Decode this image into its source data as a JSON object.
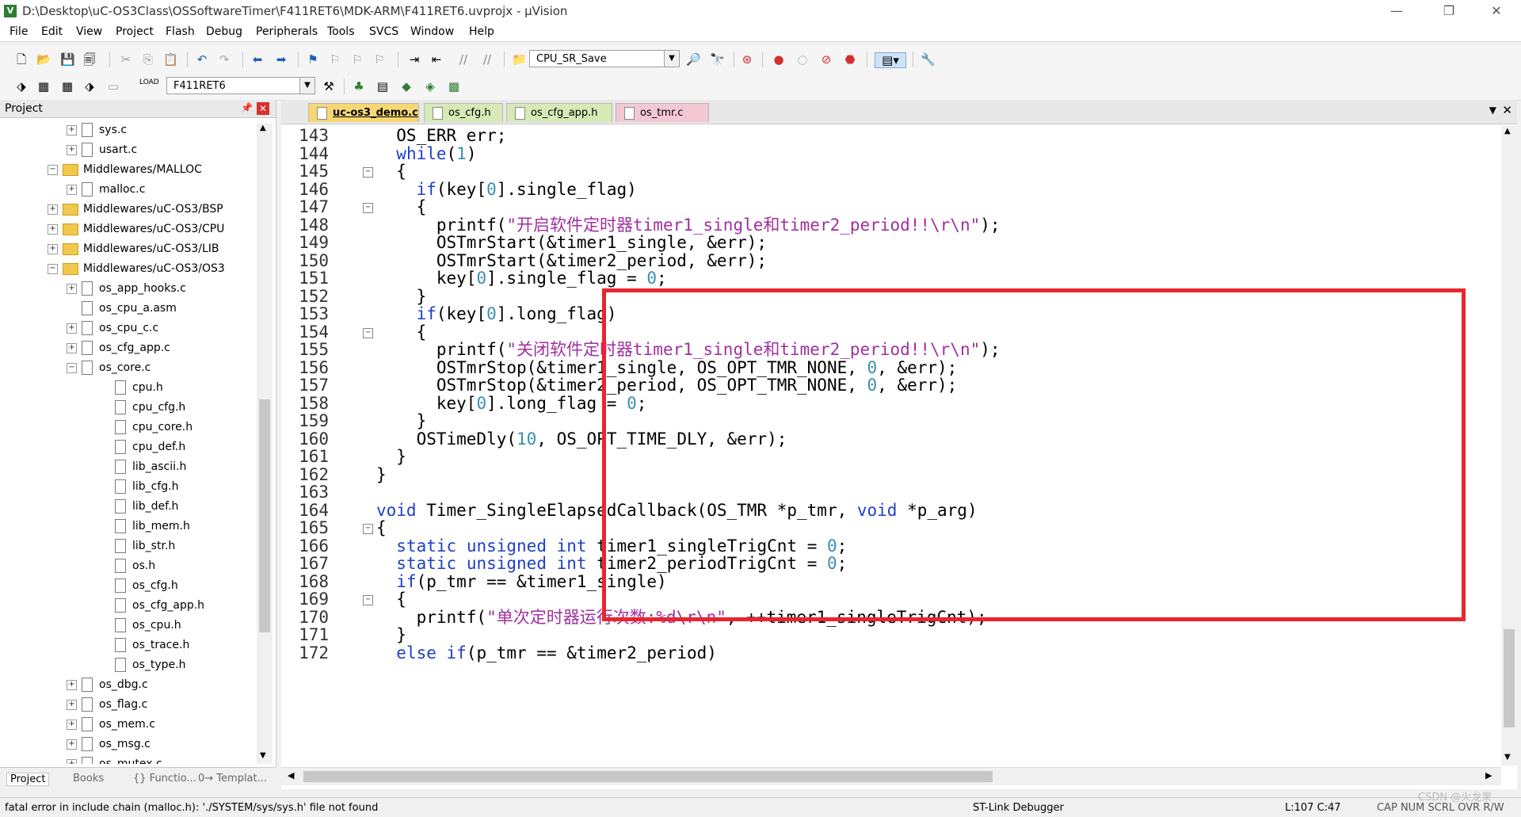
{
  "window": {
    "title": "D:\\Desktop\\uC-OS3Class\\OSSoftwareTimer\\F411RET6\\MDK-ARM\\F411RET6.uvprojx - µVision",
    "app_icon": "V"
  },
  "menu": [
    "File",
    "Edit",
    "View",
    "Project",
    "Flash",
    "Debug",
    "Peripherals",
    "Tools",
    "SVCS",
    "Window",
    "Help"
  ],
  "toolbar1": {
    "combo": "CPU_SR_Save"
  },
  "toolbar2": {
    "target": "F411RET6",
    "load_label": "LOAD"
  },
  "project_panel": {
    "title": "Project",
    "tree": [
      {
        "label": "sys.c",
        "type": "file",
        "exp": "+"
      },
      {
        "label": "usart.c",
        "type": "file",
        "exp": "+"
      },
      {
        "label": "Middlewares/MALLOC",
        "type": "folder",
        "exp": "-"
      },
      {
        "label": "malloc.c",
        "type": "file",
        "exp": "+"
      },
      {
        "label": "Middlewares/uC-OS3/BSP",
        "type": "folder",
        "exp": "+"
      },
      {
        "label": "Middlewares/uC-OS3/CPU",
        "type": "folder",
        "exp": "+"
      },
      {
        "label": "Middlewares/uC-OS3/LIB",
        "type": "folder",
        "exp": "+"
      },
      {
        "label": "Middlewares/uC-OS3/OS3",
        "type": "folder",
        "exp": "-"
      },
      {
        "label": "os_app_hooks.c",
        "type": "file",
        "exp": "+"
      },
      {
        "label": "os_cpu_a.asm",
        "type": "file",
        "exp": ""
      },
      {
        "label": "os_cpu_c.c",
        "type": "file",
        "exp": "+"
      },
      {
        "label": "os_cfg_app.c",
        "type": "file",
        "exp": "+"
      },
      {
        "label": "os_core.c",
        "type": "file",
        "exp": "-"
      },
      {
        "label": "cpu.h",
        "type": "file",
        "exp": ""
      },
      {
        "label": "cpu_cfg.h",
        "type": "file",
        "exp": ""
      },
      {
        "label": "cpu_core.h",
        "type": "file",
        "exp": ""
      },
      {
        "label": "cpu_def.h",
        "type": "file",
        "exp": ""
      },
      {
        "label": "lib_ascii.h",
        "type": "file",
        "exp": ""
      },
      {
        "label": "lib_cfg.h",
        "type": "file",
        "exp": ""
      },
      {
        "label": "lib_def.h",
        "type": "file",
        "exp": ""
      },
      {
        "label": "lib_mem.h",
        "type": "file",
        "exp": ""
      },
      {
        "label": "lib_str.h",
        "type": "file",
        "exp": ""
      },
      {
        "label": "os.h",
        "type": "file",
        "exp": ""
      },
      {
        "label": "os_cfg.h",
        "type": "file",
        "exp": ""
      },
      {
        "label": "os_cfg_app.h",
        "type": "file",
        "exp": ""
      },
      {
        "label": "os_cpu.h",
        "type": "file",
        "exp": ""
      },
      {
        "label": "os_trace.h",
        "type": "file",
        "exp": ""
      },
      {
        "label": "os_type.h",
        "type": "file",
        "exp": ""
      },
      {
        "label": "os_dbg.c",
        "type": "file",
        "exp": "+"
      },
      {
        "label": "os_flag.c",
        "type": "file",
        "exp": "+"
      },
      {
        "label": "os_mem.c",
        "type": "file",
        "exp": "+"
      },
      {
        "label": "os_msg.c",
        "type": "file",
        "exp": "+"
      },
      {
        "label": "os_mutex.c",
        "type": "file",
        "exp": "+"
      }
    ],
    "bottom_tabs": [
      "Project",
      "Books",
      "{} Functio...",
      "0→ Templat..."
    ]
  },
  "editor": {
    "tabs": [
      {
        "label": "uc-os3_demo.c",
        "active": true,
        "color": "#f7d774"
      },
      {
        "label": "os_cfg.h",
        "active": false,
        "color": "#d6e9b6"
      },
      {
        "label": "os_cfg_app.h",
        "active": false,
        "color": "#d6e9b6"
      },
      {
        "label": "os_tmr.c",
        "active": false,
        "color": "#f3c8d4"
      }
    ],
    "lines": [
      {
        "n": "143",
        "fold": "",
        "code": "  OS_ERR err;"
      },
      {
        "n": "144",
        "fold": "",
        "code": "  while(1)"
      },
      {
        "n": "145",
        "fold": "-",
        "code": "  {"
      },
      {
        "n": "146",
        "fold": "",
        "code": "    if(key[0].single_flag)"
      },
      {
        "n": "147",
        "fold": "-",
        "code": "    {"
      },
      {
        "n": "148",
        "fold": "",
        "code": "      printf(\"开启软件定时器timer1_single和timer2_period!!\\r\\n\");"
      },
      {
        "n": "149",
        "fold": "",
        "code": "      OSTmrStart(&timer1_single, &err);"
      },
      {
        "n": "150",
        "fold": "",
        "code": "      OSTmrStart(&timer2_period, &err);"
      },
      {
        "n": "151",
        "fold": "",
        "code": "      key[0].single_flag = 0;"
      },
      {
        "n": "152",
        "fold": "",
        "code": "    }"
      },
      {
        "n": "153",
        "fold": "",
        "code": "    if(key[0].long_flag)"
      },
      {
        "n": "154",
        "fold": "-",
        "code": "    {"
      },
      {
        "n": "155",
        "fold": "",
        "code": "      printf(\"关闭软件定时器timer1_single和timer2_period!!\\r\\n\");"
      },
      {
        "n": "156",
        "fold": "",
        "code": "      OSTmrStop(&timer1_single, OS_OPT_TMR_NONE, 0, &err);"
      },
      {
        "n": "157",
        "fold": "",
        "code": "      OSTmrStop(&timer2_period, OS_OPT_TMR_NONE, 0, &err);"
      },
      {
        "n": "158",
        "fold": "",
        "code": "      key[0].long_flag = 0;"
      },
      {
        "n": "159",
        "fold": "",
        "code": "    }"
      },
      {
        "n": "160",
        "fold": "",
        "code": "    OSTimeDly(10, OS_OPT_TIME_DLY, &err);"
      },
      {
        "n": "161",
        "fold": "",
        "code": "  }"
      },
      {
        "n": "162",
        "fold": "",
        "code": "}"
      },
      {
        "n": "163",
        "fold": "",
        "code": ""
      },
      {
        "n": "164",
        "fold": "",
        "code": "void Timer_SingleElapsedCallback(OS_TMR *p_tmr, void *p_arg)"
      },
      {
        "n": "165",
        "fold": "-",
        "code": "{"
      },
      {
        "n": "166",
        "fold": "",
        "code": "  static unsigned int timer1_singleTrigCnt = 0;"
      },
      {
        "n": "167",
        "fold": "",
        "code": "  static unsigned int timer2_periodTrigCnt = 0;"
      },
      {
        "n": "168",
        "fold": "",
        "code": "  if(p_tmr == &timer1_single)"
      },
      {
        "n": "169",
        "fold": "-",
        "code": "  {"
      },
      {
        "n": "170",
        "fold": "",
        "code": "    printf(\"单次定时器运行次数:%d\\r\\n\", ++timer1_singleTrigCnt);"
      },
      {
        "n": "171",
        "fold": "",
        "code": "  }"
      },
      {
        "n": "172",
        "fold": "",
        "code": "  else if(p_tmr == &timer2_period)"
      }
    ]
  },
  "status": {
    "message": "fatal error in include chain (malloc.h): './SYSTEM/sys/sys.h' file not found",
    "debugger": "ST-Link Debugger",
    "position": "L:107 C:47",
    "indicators": "CAP  NUM  SCRL  OVR  R/W",
    "watermark": "CSDN @火龙果"
  },
  "colors": {
    "highlight_box": "#e8262d",
    "keyword": "#1e3fc6",
    "string": "#a0309f",
    "number": "#3b8fb1"
  }
}
